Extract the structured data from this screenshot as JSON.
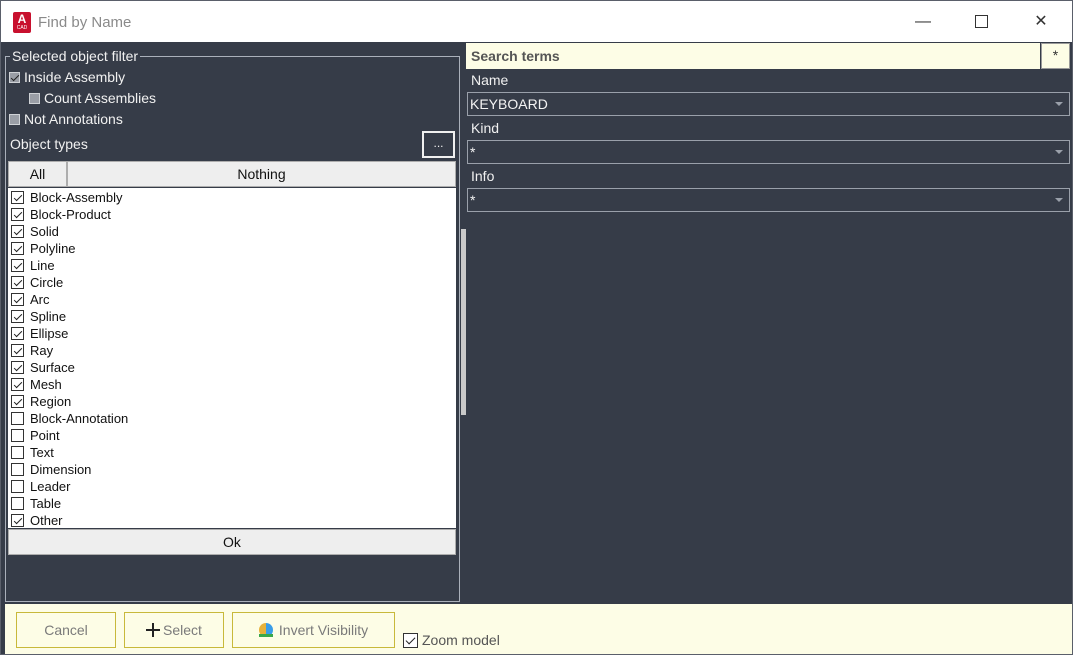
{
  "window": {
    "title": "Find by Name",
    "app_icon_letter": "A",
    "app_icon_sub": "CAD",
    "minimize_glyph": "—",
    "close_glyph": "✕"
  },
  "filter": {
    "legend": "Selected object filter",
    "inside_assembly": {
      "label": "Inside Assembly",
      "checked": true
    },
    "count_assemblies": {
      "label": "Count Assemblies",
      "checked": false
    },
    "not_annotations": {
      "label": "Not Annotations",
      "checked": false
    },
    "object_types_label": "Object types",
    "more_button": "...",
    "all_button": "All",
    "nothing_button": "Nothing",
    "types": [
      {
        "label": "Block-Assembly",
        "checked": true
      },
      {
        "label": "Block-Product",
        "checked": true
      },
      {
        "label": "Solid",
        "checked": true
      },
      {
        "label": "Polyline",
        "checked": true
      },
      {
        "label": "Line",
        "checked": true
      },
      {
        "label": "Circle",
        "checked": true
      },
      {
        "label": "Arc",
        "checked": true
      },
      {
        "label": "Spline",
        "checked": true
      },
      {
        "label": "Ellipse",
        "checked": true
      },
      {
        "label": "Ray",
        "checked": true
      },
      {
        "label": "Surface",
        "checked": true
      },
      {
        "label": "Mesh",
        "checked": true
      },
      {
        "label": "Region",
        "checked": true
      },
      {
        "label": "Block-Annotation",
        "checked": false
      },
      {
        "label": "Point",
        "checked": false
      },
      {
        "label": "Text",
        "checked": false
      },
      {
        "label": "Dimension",
        "checked": false
      },
      {
        "label": "Leader",
        "checked": false
      },
      {
        "label": "Table",
        "checked": false
      },
      {
        "label": "Other",
        "checked": true
      }
    ],
    "ok_button": "Ok"
  },
  "search": {
    "header": "Search terms",
    "star_button": "*",
    "name_label": "Name",
    "name_value": "KEYBOARD",
    "kind_label": "Kind",
    "kind_value": "*",
    "info_label": "Info",
    "info_value": "*"
  },
  "bottom": {
    "cancel_button": "Cancel",
    "select_button": "Select",
    "invert_button": "Invert Visibility",
    "zoom_label": "Zoom model",
    "zoom_checked": true
  },
  "colors": {
    "panel_bg": "#363c48",
    "accent_bg": "#fdfde6",
    "app_icon_red": "#c8102e"
  }
}
